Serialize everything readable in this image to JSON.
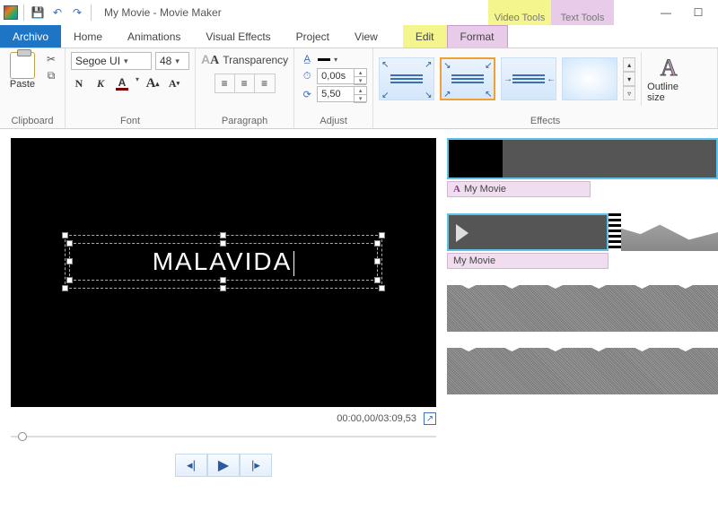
{
  "title": "My Movie - Movie Maker",
  "context_tabs": {
    "video": "Video Tools",
    "text": "Text Tools"
  },
  "tabs": {
    "file": "Archivo",
    "home": "Home",
    "animations": "Animations",
    "visual": "Visual Effects",
    "project": "Project",
    "view": "View",
    "edit": "Edit",
    "format": "Format"
  },
  "groups": {
    "clipboard": "Clipboard",
    "font": "Font",
    "paragraph": "Paragraph",
    "adjust": "Adjust",
    "effects": "Effects"
  },
  "clipboard": {
    "paste": "Paste"
  },
  "font": {
    "name": "Segoe UI",
    "size": "48",
    "bold_glyph": "N",
    "italic_glyph": "K",
    "color_glyph": "A",
    "grow_glyph": "A",
    "shrink_glyph": "A"
  },
  "paragraph": {
    "transparency": "Transparency",
    "trans_glyph": "A"
  },
  "adjust": {
    "start_time": "0,00s",
    "duration": "5,50"
  },
  "outline": {
    "label": "Outline size",
    "caret": "▾"
  },
  "preview": {
    "text": "MALAVIDA",
    "timecode": "00:00,00/03:09,53"
  },
  "timeline": {
    "label1": "My Movie",
    "label2": "My Movie"
  }
}
